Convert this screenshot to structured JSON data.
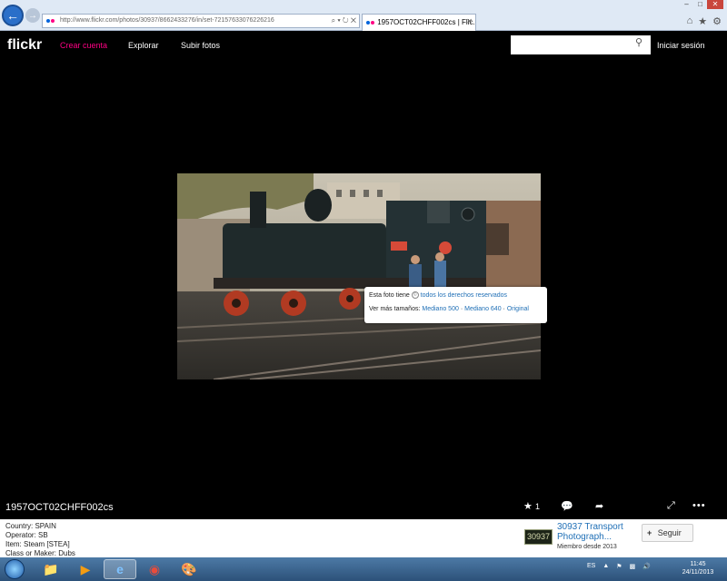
{
  "browser": {
    "url": "http://www.flickr.com/photos/30937/8662433276/in/set-72157633076226216",
    "url_host": "www.flickr.com",
    "tab_title": "1957OCT02CHFF002cs | Flic...",
    "back_icon": "arrow-left",
    "forward_icon": "arrow-right"
  },
  "header": {
    "logo": "flickr",
    "nav": [
      "Crear cuenta",
      "Explorar",
      "Subir fotos"
    ],
    "search_placeholder": "",
    "signin": "Iniciar sesión"
  },
  "tooltip": {
    "rights_prefix": "Esta foto tiene",
    "rights_link": "todos los derechos reservados",
    "sizes_prefix": "Ver más tamaños:",
    "size_500": "Mediano 500",
    "size_640": "Mediano 640",
    "size_original": "Original",
    "sep": "·"
  },
  "photo": {
    "title": "1957OCT02CHFF002cs",
    "plate_text": "",
    "fav_count": "1"
  },
  "meta": [
    "Country: SPAIN",
    "Operator: SB",
    "Item: Steam [STEA]",
    "Class or Maker: Dubs"
  ],
  "owner": {
    "thumb_text": "30937",
    "name_line1": "30937 Transport",
    "name_line2": "Photograph...",
    "since": "Miembro desde 2013",
    "follow_label": "Seguir"
  },
  "taskbar": {
    "lang": "ES",
    "time": "11:45",
    "date": "24/11/2013"
  },
  "colors": {
    "flickr_pink": "#ff0084",
    "link_blue": "#1f6fb6"
  }
}
